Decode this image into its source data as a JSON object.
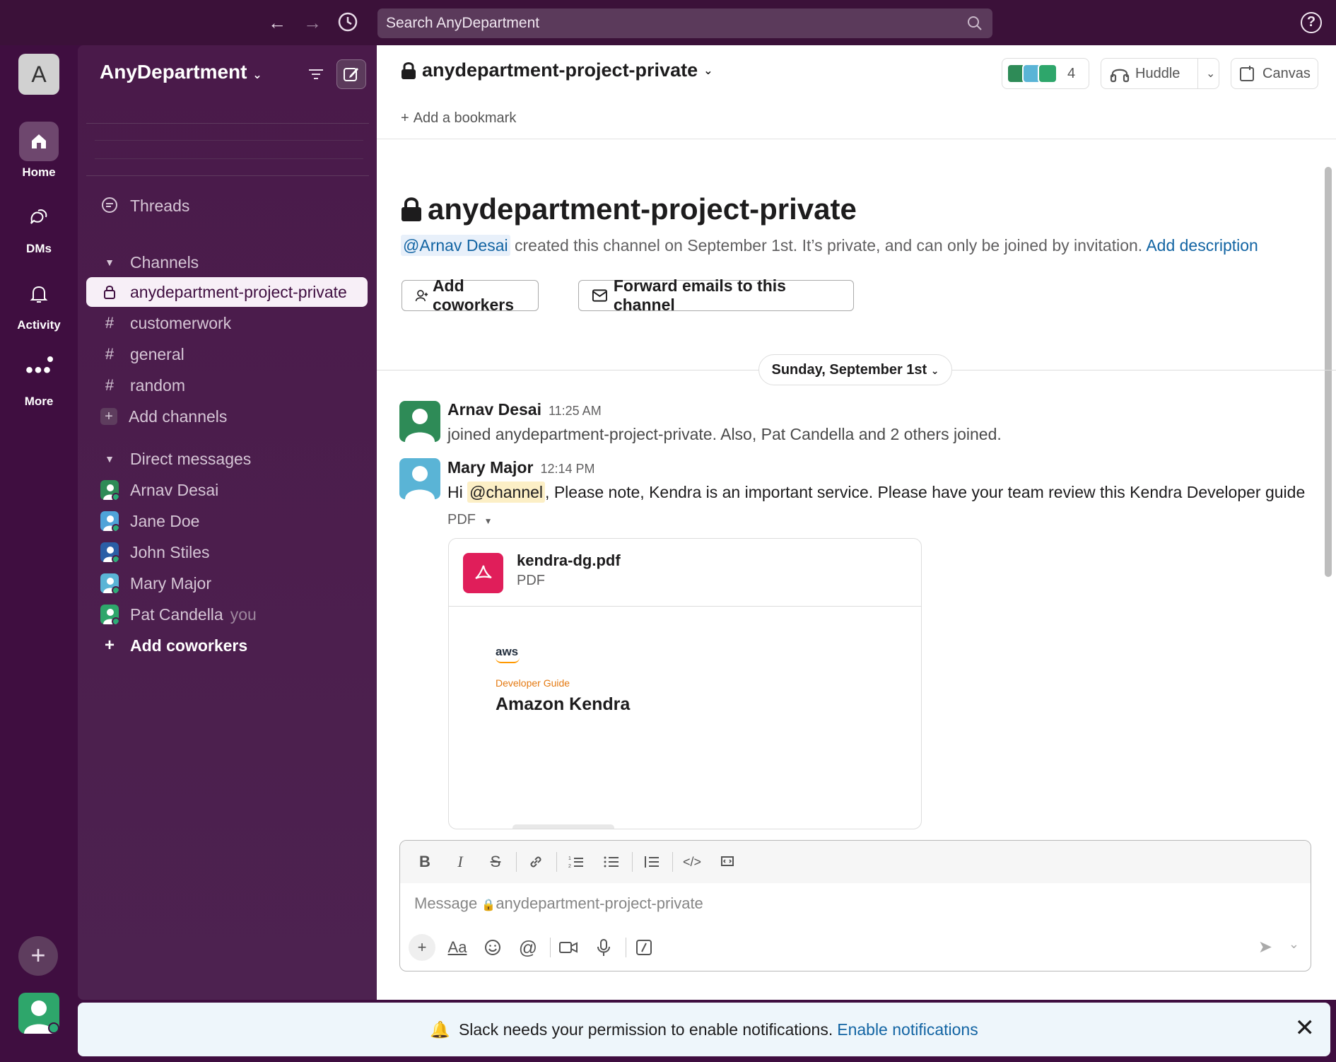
{
  "topbar": {
    "search_placeholder": "Search AnyDepartment",
    "help_label": "?"
  },
  "rail": {
    "workspace_initial": "A",
    "items": [
      {
        "label": "Home",
        "icon": "home-icon"
      },
      {
        "label": "DMs",
        "icon": "dms-icon"
      },
      {
        "label": "Activity",
        "icon": "bell-icon"
      },
      {
        "label": "More",
        "icon": "more-icon"
      }
    ]
  },
  "sidebar": {
    "workspace_name": "AnyDepartment",
    "threads_label": "Threads",
    "channels_header": "Channels",
    "channels": [
      {
        "name": "anydepartment-project-private",
        "type": "private",
        "active": true
      },
      {
        "name": "customerwork",
        "type": "public"
      },
      {
        "name": "general",
        "type": "public"
      },
      {
        "name": "random",
        "type": "public"
      }
    ],
    "add_channels": "Add channels",
    "dm_header": "Direct messages",
    "dms": [
      {
        "name": "Arnav Desai",
        "color": "#2e8b57"
      },
      {
        "name": "Jane Doe",
        "color": "#4fa3d9"
      },
      {
        "name": "John Stiles",
        "color": "#2b5fa6"
      },
      {
        "name": "Mary Major",
        "color": "#5ab4d6"
      },
      {
        "name": "Pat Candella",
        "color": "#2ea66b",
        "suffix": "you"
      }
    ],
    "add_coworkers": "Add coworkers"
  },
  "channel": {
    "name": "anydepartment-project-private",
    "member_count": "4",
    "huddle_label": "Huddle",
    "canvas_label": "Canvas",
    "bookmark_label": "Add a bookmark",
    "intro": {
      "creator": "@Arnav Desai",
      "text": " created this channel on September 1st. It’s private, and can only be joined by invitation. ",
      "add_description": "Add description"
    },
    "add_coworkers_btn": "Add coworkers",
    "forward_emails_btn": "Forward emails to this channel",
    "date_divider": "Sunday, September 1st"
  },
  "messages": [
    {
      "author": "Arnav Desai",
      "time": "11:25 AM",
      "text": "joined anydepartment-project-private. Also, Pat Candella and 2 others joined."
    },
    {
      "author": "Mary Major",
      "time": "12:14 PM",
      "text_prefix": "Hi ",
      "mention": "@channel",
      "text_suffix": ", Please note, Kendra is an important service. Please have your team review this Kendra Developer guide",
      "attachment_label": "PDF",
      "file": {
        "name": "kendra-dg.pdf",
        "type": "PDF",
        "preview_brand": "aws",
        "preview_subtitle": "Developer Guide",
        "preview_title": "Amazon Kendra"
      }
    }
  ],
  "composer": {
    "placeholder": "Message ",
    "placeholder_channel": "anydepartment-project-private"
  },
  "banner": {
    "text": "Slack needs your permission to enable notifications. ",
    "link": "Enable notifications"
  },
  "colors": {
    "aubergine": "#3f0e40",
    "link": "#1264a3",
    "pdf": "#e01e5a"
  }
}
